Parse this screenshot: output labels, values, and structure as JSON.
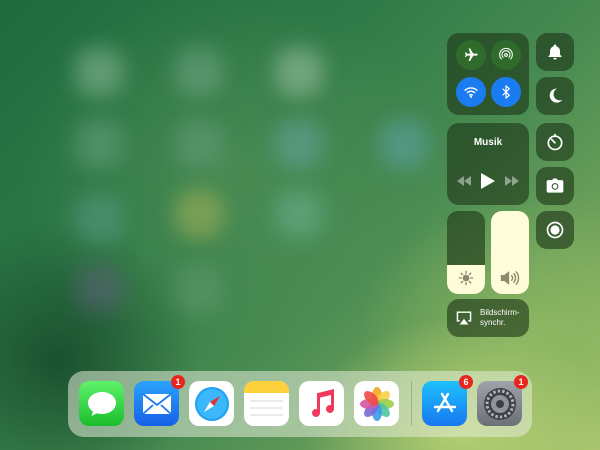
{
  "control_center": {
    "connectivity": {
      "airplane_mode_icon": "airplane-icon",
      "airdrop_icon": "airdrop-icon",
      "wifi_icon": "wifi-icon",
      "bluetooth_icon": "bluetooth-icon",
      "active_color": "#1a7cf0",
      "inactive_color": "#2f6b2a"
    },
    "music": {
      "title": "Musik",
      "rewind_icon": "rewind-icon",
      "play_icon": "play-icon",
      "forward_icon": "fast-forward-icon"
    },
    "brightness_level": 0.35,
    "volume_level": 1.0,
    "screen_mirroring": {
      "label_line1": "Bildschirm-",
      "label_line2": "synchr."
    },
    "side_buttons": [
      "bell-icon",
      "moon-icon",
      "timer-icon",
      "camera-icon",
      "record-icon"
    ]
  },
  "dock": {
    "apps": [
      {
        "name": "messages",
        "icon": "messages-icon",
        "badge": ""
      },
      {
        "name": "mail",
        "icon": "mail-icon",
        "badge": "1"
      },
      {
        "name": "safari",
        "icon": "safari-icon",
        "badge": ""
      },
      {
        "name": "notes",
        "icon": "notes-icon",
        "badge": ""
      },
      {
        "name": "music",
        "icon": "music-icon",
        "badge": ""
      },
      {
        "name": "photos",
        "icon": "photos-icon",
        "badge": ""
      },
      {
        "name": "app-store",
        "icon": "app-store-icon",
        "badge": "6"
      },
      {
        "name": "settings",
        "icon": "settings-icon",
        "badge": "1"
      }
    ]
  }
}
